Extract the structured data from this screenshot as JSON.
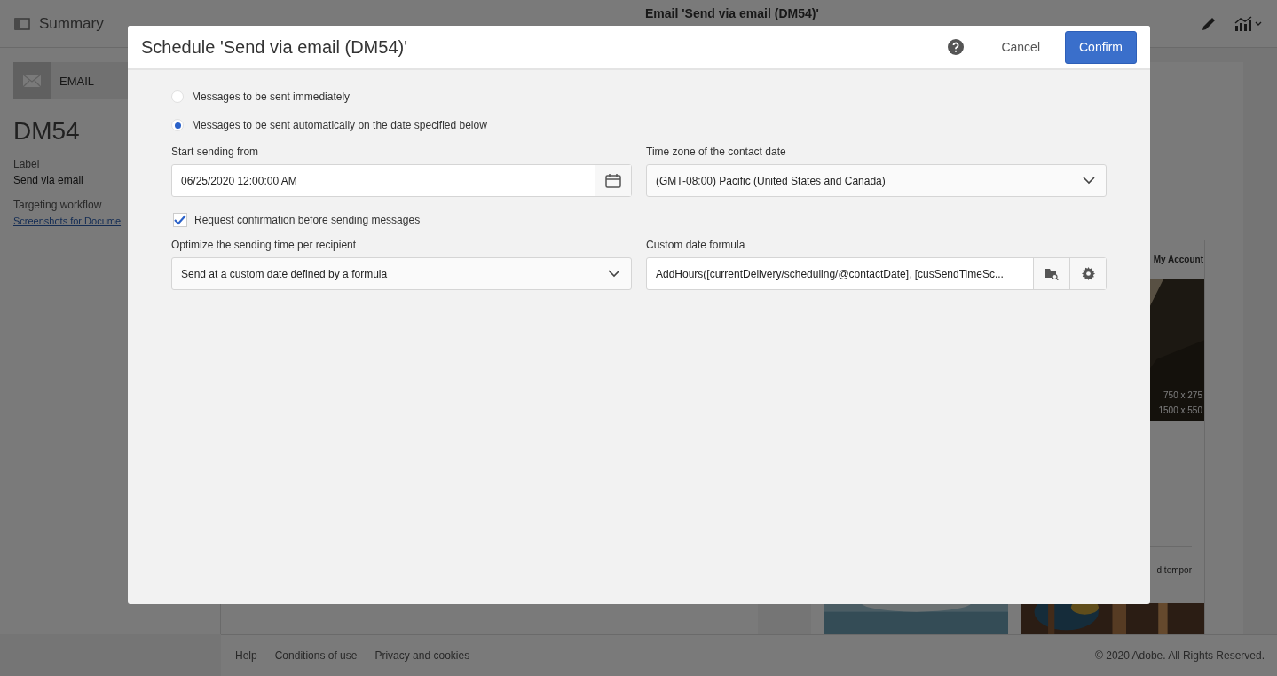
{
  "header": {
    "title": "Summary",
    "document_title": "Email 'Send via email (DM54)'"
  },
  "sidebar": {
    "channel": "EMAIL",
    "name": "DM54",
    "fields": [
      {
        "label": "Label",
        "value": "Send via email",
        "kind": "text"
      },
      {
        "label": "Targeting workflow",
        "value": "Screenshots for Docume",
        "kind": "link"
      }
    ]
  },
  "preview": {
    "menu_link": "My Account",
    "image_sizes": [
      "750 x 275",
      "1500 x 550"
    ],
    "text": "d tempor"
  },
  "footer": {
    "links": [
      "Help",
      "Conditions of use",
      "Privacy and cookies"
    ],
    "copyright": "© 2020 Adobe. All Rights Reserved."
  },
  "dialog": {
    "title": "Schedule 'Send via email (DM54)'",
    "cancel": "Cancel",
    "confirm": "Confirm",
    "send_options": [
      {
        "label": "Messages to be sent immediately",
        "selected": false
      },
      {
        "label": "Messages to be sent automatically on the date specified below",
        "selected": true
      }
    ],
    "start_from": {
      "label": "Start sending from",
      "value": "06/25/2020 12:00:00 AM"
    },
    "time_zone": {
      "label": "Time zone of the contact date",
      "value": "(GMT-08:00) Pacific (United States and Canada)"
    },
    "request_confirmation": {
      "label": "Request confirmation before sending messages",
      "checked": true
    },
    "optimize": {
      "label": "Optimize the sending time per recipient",
      "value": "Send at a custom date defined by a formula"
    },
    "formula": {
      "label": "Custom date formula",
      "value": "AddHours([currentDelivery/scheduling/@contactDate], [cusSendTimeSc..."
    }
  }
}
